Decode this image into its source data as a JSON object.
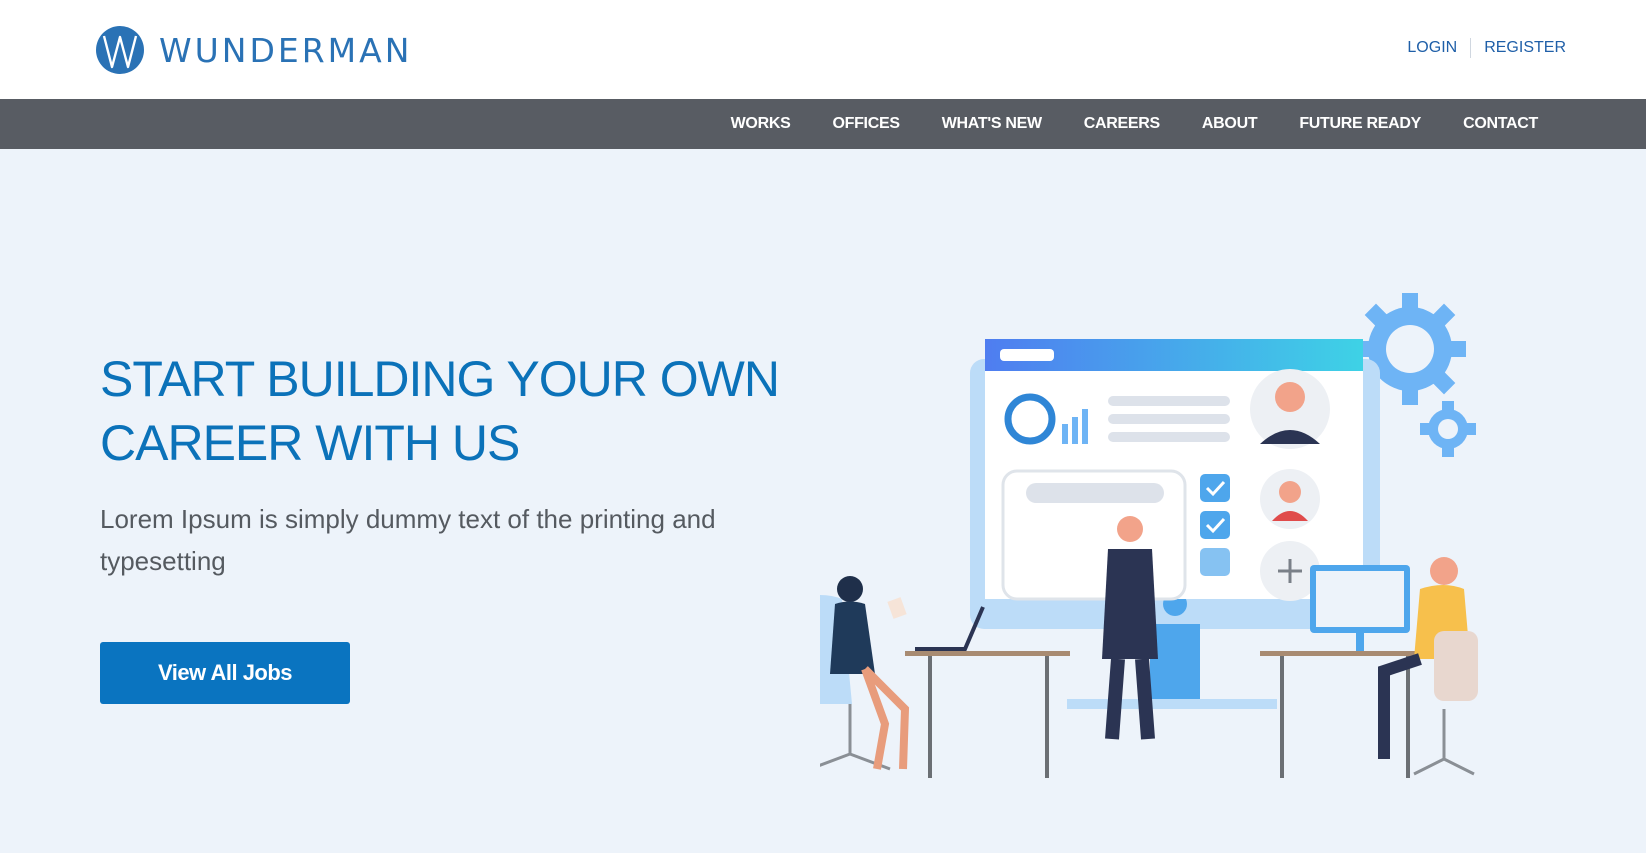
{
  "brand": {
    "name": "WUNDERMAN",
    "color": "#2a72b5"
  },
  "auth": {
    "login": "LOGIN",
    "register": "REGISTER"
  },
  "nav": {
    "items": [
      "WORKS",
      "OFFICES",
      "WHAT'S NEW",
      "CAREERS",
      "ABOUT",
      "FUTURE READY",
      "CONTACT"
    ],
    "background": "#585c63"
  },
  "hero": {
    "title_line1": "START BUILDING YOUR OWN",
    "title_line2": "CAREER WITH US",
    "subtitle": "Lorem Ipsum is simply dummy text of the printing and typesetting",
    "cta_label": "View All Jobs",
    "background": "#edf3fa",
    "accent": "#0a74c0"
  },
  "illustration": {
    "icon": "office-team-dashboard-illustration"
  }
}
